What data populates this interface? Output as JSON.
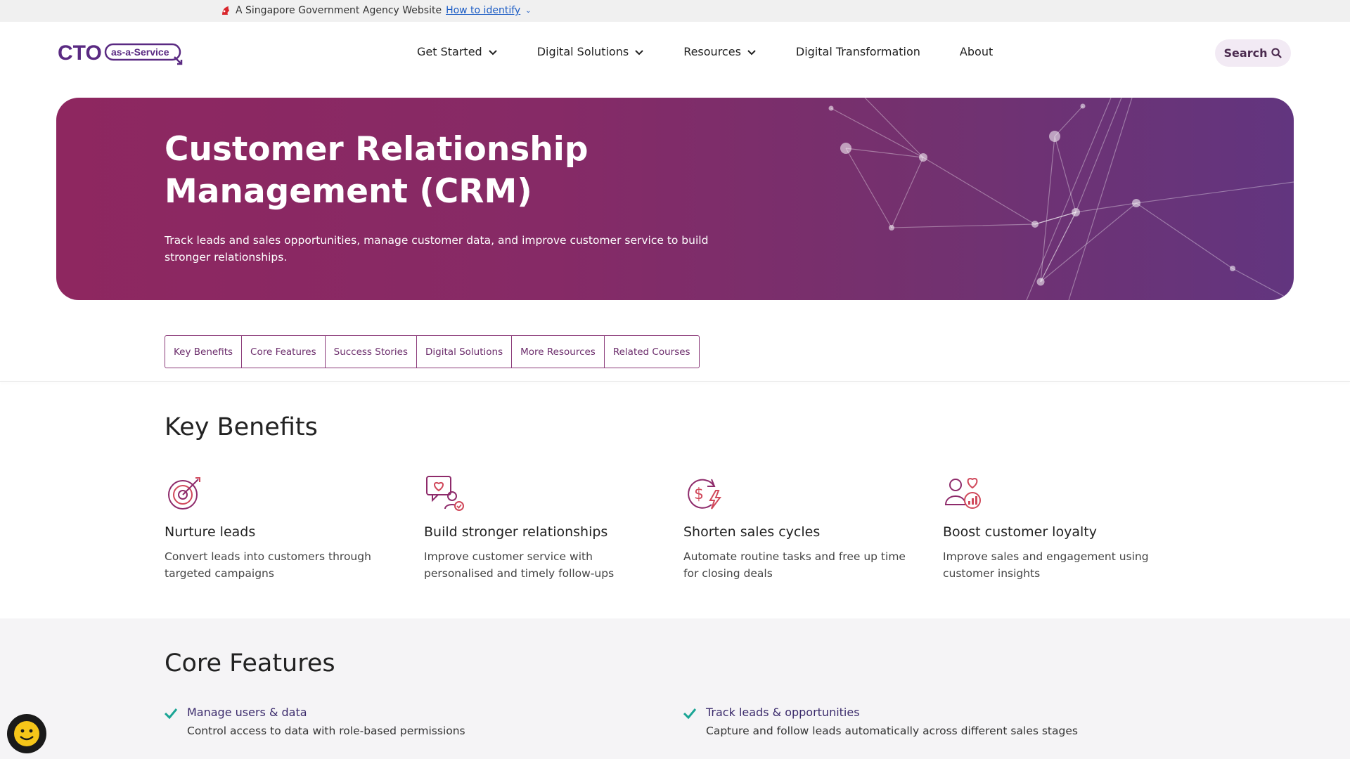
{
  "masthead": {
    "text": "A Singapore Government Agency Website",
    "link": "How to identify"
  },
  "header": {
    "logo_main": "CTO",
    "logo_sub": "as-a-Service",
    "nav": [
      {
        "label": "Get Started",
        "has_dropdown": true
      },
      {
        "label": "Digital Solutions",
        "has_dropdown": true
      },
      {
        "label": "Resources",
        "has_dropdown": true
      },
      {
        "label": "Digital Transformation",
        "has_dropdown": false
      },
      {
        "label": "About",
        "has_dropdown": false
      }
    ],
    "search_label": "Search"
  },
  "hero": {
    "title": "Customer Relationship Management (CRM)",
    "description": "Track leads and sales opportunities, manage customer data, and improve customer service to build stronger relationships."
  },
  "tabs": [
    "Key Benefits",
    "Core Features",
    "Success Stories",
    "Digital Solutions",
    "More Resources",
    "Related Courses"
  ],
  "key_benefits": {
    "title": "Key Benefits",
    "items": [
      {
        "icon": "target-icon",
        "title": "Nurture leads",
        "description": "Convert leads into customers through targeted campaigns"
      },
      {
        "icon": "chat-heart-icon",
        "title": "Build stronger relationships",
        "description": "Improve customer service with personalised and timely follow-ups"
      },
      {
        "icon": "dollar-lightning-icon",
        "title": "Shorten sales cycles",
        "description": "Automate routine tasks and free up time for closing deals"
      },
      {
        "icon": "loyalty-chart-icon",
        "title": "Boost customer loyalty",
        "description": "Improve sales and engagement using customer insights"
      }
    ]
  },
  "core_features": {
    "title": "Core Features",
    "items": [
      {
        "title": "Manage users & data",
        "description": "Control access to data with role-based permissions"
      },
      {
        "title": "Track leads & opportunities",
        "description": "Capture and follow leads automatically across different sales stages"
      }
    ]
  },
  "colors": {
    "brand_purple": "#6b2c6b",
    "hero_start": "#8e2760",
    "hero_end": "#62357f",
    "check_teal": "#1aa595"
  }
}
